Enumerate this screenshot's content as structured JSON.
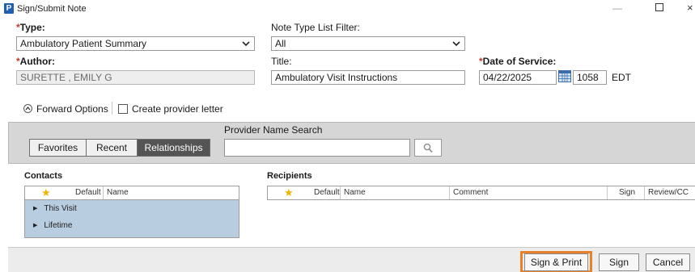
{
  "window": {
    "title": "Sign/Submit Note",
    "app_icon_letter": "P",
    "minimize_glyph": "—",
    "close_glyph": "×"
  },
  "type": {
    "required_mark": "*",
    "label": "Type:",
    "value": "Ambulatory Patient Summary"
  },
  "note_type_filter": {
    "label": "Note Type List Filter:",
    "value": "All"
  },
  "author": {
    "required_mark": "*",
    "label": "Author:",
    "value": "SURETTE , EMILY G"
  },
  "title_field": {
    "label": "Title:",
    "value": "Ambulatory Visit Instructions"
  },
  "date_of_service": {
    "required_mark": "*",
    "label": "Date of Service:",
    "date": "04/22/2025",
    "time": "1058",
    "timezone": "EDT"
  },
  "forward_options": {
    "label": "Forward Options",
    "create_letter_label": "Create provider letter",
    "create_letter_checked": false
  },
  "provider_search": {
    "label": "Provider Name Search",
    "tabs": [
      "Favorites",
      "Recent",
      "Relationships"
    ],
    "active_tab": "Relationships",
    "search_value": ""
  },
  "contacts": {
    "label": "Contacts",
    "columns": [
      "Default",
      "Name"
    ],
    "rows": [
      "This Visit",
      "Lifetime"
    ]
  },
  "recipients": {
    "label": "Recipients",
    "columns": [
      "Default",
      "Name",
      "Comment",
      "Sign",
      "Review/CC"
    ]
  },
  "buttons": {
    "sign_print": "Sign & Print",
    "sign": "Sign",
    "cancel": "Cancel"
  },
  "colors": {
    "active_tab": "#545454",
    "highlight": "#e8822a",
    "required": "#c0392b",
    "contacts_body": "#b9cde0"
  }
}
